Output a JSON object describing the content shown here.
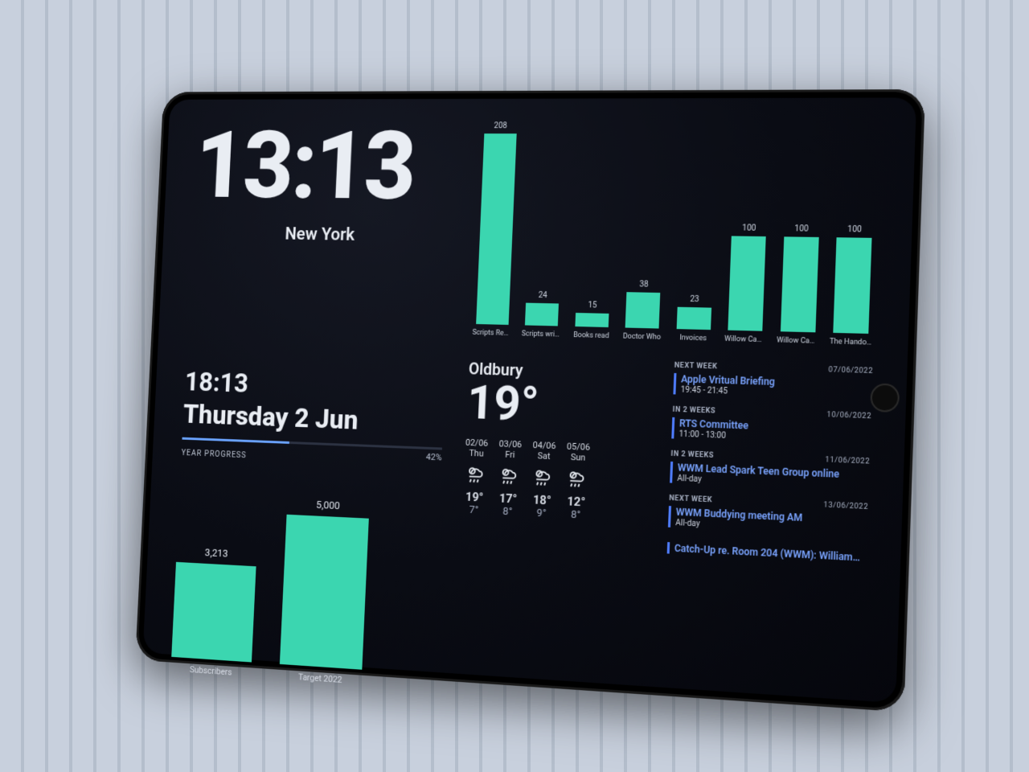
{
  "colors": {
    "accent": "#3bd6b0",
    "link": "#7aa4ff",
    "bar_accent": "#6aa3ff"
  },
  "clock": {
    "primary_time": "13:13",
    "primary_city": "New York",
    "secondary_time": "18:13",
    "date_line": "Thursday 2 Jun"
  },
  "year_progress": {
    "label": "YEAR PROGRESS",
    "percent": 42,
    "percent_text": "42%"
  },
  "weather": {
    "location": "Oldbury",
    "current_temp": "19°",
    "forecast": [
      {
        "date": "02/06",
        "dow": "Thu",
        "hi": "19°",
        "lo": "7°"
      },
      {
        "date": "03/06",
        "dow": "Fri",
        "hi": "17°",
        "lo": "8°"
      },
      {
        "date": "04/06",
        "dow": "Sat",
        "hi": "18°",
        "lo": "9°"
      },
      {
        "date": "05/06",
        "dow": "Sun",
        "hi": "12°",
        "lo": "8°"
      }
    ]
  },
  "agenda": [
    {
      "when": "NEXT WEEK",
      "date": "07/06/2022",
      "title": "Apple Vritual Briefing",
      "time": "19:45 - 21:45"
    },
    {
      "when": "IN 2 WEEKS",
      "date": "10/06/2022",
      "title": "RTS Committee",
      "time": "11:00 - 13:00"
    },
    {
      "when": "IN 2 WEEKS",
      "date": "11/06/2022",
      "title": "WWM Lead Spark Teen Group online",
      "time": "All-day"
    },
    {
      "when": "NEXT WEEK",
      "date": "13/06/2022",
      "title": "WWM Buddying meeting AM",
      "time": "All-day"
    },
    {
      "when": "",
      "date": "",
      "title": "Catch-Up re. Room 204 (WWM): William…",
      "time": ""
    }
  ],
  "chart_data": [
    {
      "type": "bar",
      "title": "",
      "categories": [
        "Scripts Read",
        "Scripts written",
        "Books read",
        "Doctor Who",
        "Invoices",
        "Willow Cabins…",
        "Willow Cabins…",
        "The Handover…"
      ],
      "values": [
        208,
        24,
        15,
        38,
        23,
        100,
        100,
        100
      ],
      "ylim": [
        0,
        208
      ]
    },
    {
      "type": "bar",
      "title": "",
      "categories": [
        "Subscribers",
        "Target 2022"
      ],
      "values": [
        3213,
        5000
      ],
      "value_labels": [
        "3,213",
        "5,000"
      ],
      "ylim": [
        0,
        5000
      ]
    }
  ]
}
